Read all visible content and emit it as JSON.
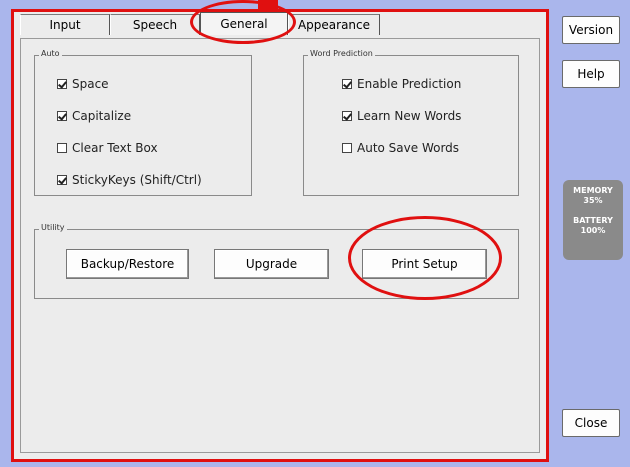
{
  "tabs": [
    "Input",
    "Speech",
    "General",
    "Appearance"
  ],
  "active_tab": "General",
  "groups": {
    "auto": {
      "title": "Auto",
      "items": [
        {
          "label": "Space",
          "checked": true
        },
        {
          "label": "Capitalize",
          "checked": true
        },
        {
          "label": "Clear Text Box",
          "checked": false
        },
        {
          "label": "StickyKeys (Shift/Ctrl)",
          "checked": true
        }
      ]
    },
    "word_prediction": {
      "title": "Word Prediction",
      "items": [
        {
          "label": "Enable Prediction",
          "checked": true
        },
        {
          "label": "Learn New Words",
          "checked": true
        },
        {
          "label": "Auto Save Words",
          "checked": false
        }
      ]
    },
    "utility": {
      "title": "Utility",
      "buttons": [
        "Backup/Restore",
        "Upgrade",
        "Print Setup"
      ]
    }
  },
  "side": {
    "version": "Version",
    "help": "Help",
    "close": "Close",
    "memory_label": "MEMORY",
    "memory_value": "35%",
    "battery_label": "BATTERY",
    "battery_value": "100%"
  },
  "colors": {
    "highlight": "#e01010",
    "background": "#aab6ec",
    "panel": "#ececec",
    "status": "#8a8a8a"
  }
}
